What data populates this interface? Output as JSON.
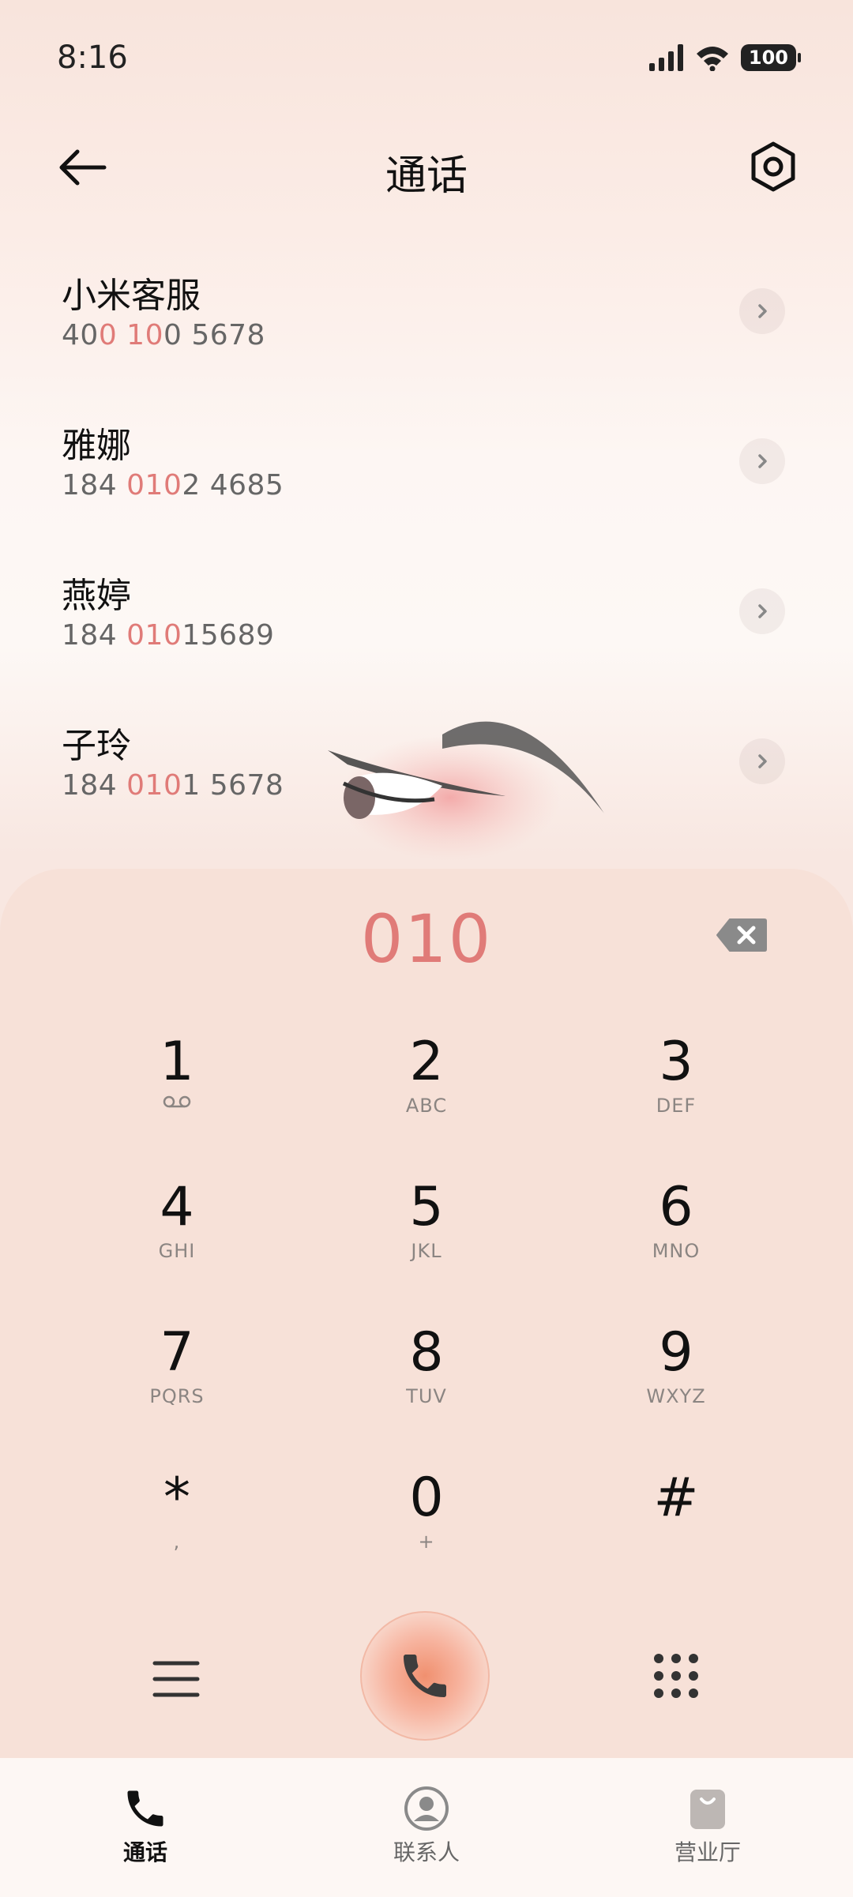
{
  "status_bar": {
    "time": "8:16",
    "battery": "100",
    "icons": [
      "signal-icon",
      "wifi-icon",
      "battery-icon"
    ]
  },
  "header": {
    "title": "通话",
    "back_icon": "arrow-left-icon",
    "settings_icon": "gear-icon"
  },
  "results": [
    {
      "name": "小米客服",
      "number_parts": [
        "40",
        "0",
        " ",
        "10",
        "0 5678"
      ],
      "highlight": [
        false,
        true,
        false,
        true,
        false
      ]
    },
    {
      "name": "雅娜",
      "number_parts": [
        "184 ",
        "010",
        "2 4685"
      ],
      "highlight": [
        false,
        true,
        false
      ]
    },
    {
      "name": "燕婷",
      "number_parts": [
        "184 ",
        "010",
        "15689"
      ],
      "highlight": [
        false,
        true,
        false
      ]
    },
    {
      "name": "子玲",
      "number_parts": [
        "184 ",
        "010",
        "1 5678"
      ],
      "highlight": [
        false,
        true,
        false
      ]
    }
  ],
  "dialpad": {
    "dialed": "010",
    "keys": [
      {
        "digit": "1",
        "letters": ""
      },
      {
        "digit": "2",
        "letters": "ABC"
      },
      {
        "digit": "3",
        "letters": "DEF"
      },
      {
        "digit": "4",
        "letters": "GHI"
      },
      {
        "digit": "5",
        "letters": "JKL"
      },
      {
        "digit": "6",
        "letters": "MNO"
      },
      {
        "digit": "7",
        "letters": "PQRS"
      },
      {
        "digit": "8",
        "letters": "TUV"
      },
      {
        "digit": "9",
        "letters": "WXYZ"
      },
      {
        "digit": "*",
        "letters": ","
      },
      {
        "digit": "0",
        "letters": "+"
      },
      {
        "digit": "#",
        "letters": ""
      }
    ]
  },
  "bottom_nav": {
    "items": [
      {
        "label": "通话",
        "icon": "phone-icon",
        "active": true
      },
      {
        "label": "联系人",
        "icon": "person-icon",
        "active": false
      },
      {
        "label": "营业厅",
        "icon": "shopping-bag-icon",
        "active": false
      }
    ]
  },
  "colors": {
    "accent": "#e07b78",
    "call_button": "#f0906f",
    "panel": "#f7e1d8"
  }
}
